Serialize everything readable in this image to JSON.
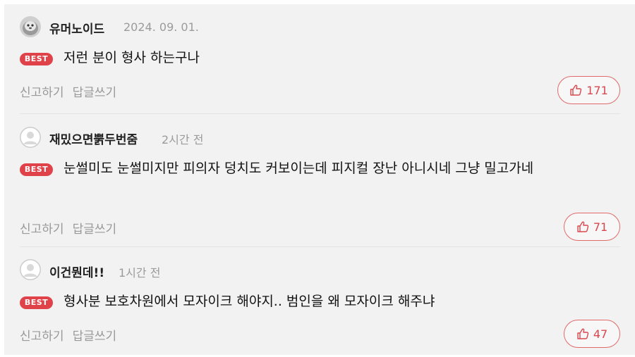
{
  "comments": [
    {
      "nickname": "유머노이드",
      "date": "2024. 09. 01.",
      "badge": "BEST",
      "text": "저런 분이 형사 하는구나",
      "report_label": "신고하기",
      "reply_label": "답글쓰기",
      "likes": "171",
      "avatar": "seal-photo-avatar"
    },
    {
      "nickname": "재밌으면뿕두번줌",
      "date": "2시간 전",
      "badge": "BEST",
      "text": "눈썰미도 눈썰미지만 피의자 덩치도 커보이는데 피지컬 장난 아니시네 그냥 밀고가네",
      "report_label": "신고하기",
      "reply_label": "답글쓰기",
      "likes": "71",
      "avatar": "default-user-avatar"
    },
    {
      "nickname": "이건뭔데!!",
      "date": "1시간 전",
      "badge": "BEST",
      "text": "형사분 보호차원에서 모자이크 해야지.. 범인을 왜 모자이크 해주냐",
      "report_label": "신고하기",
      "reply_label": "답글쓰기",
      "likes": "47",
      "avatar": "default-user-avatar"
    }
  ],
  "colors": {
    "best_badge": "#e0424a",
    "like_accent": "#d9474e",
    "panel_bg": "#f2f2f2"
  },
  "icons": {
    "like": "thumbs-up-icon"
  }
}
